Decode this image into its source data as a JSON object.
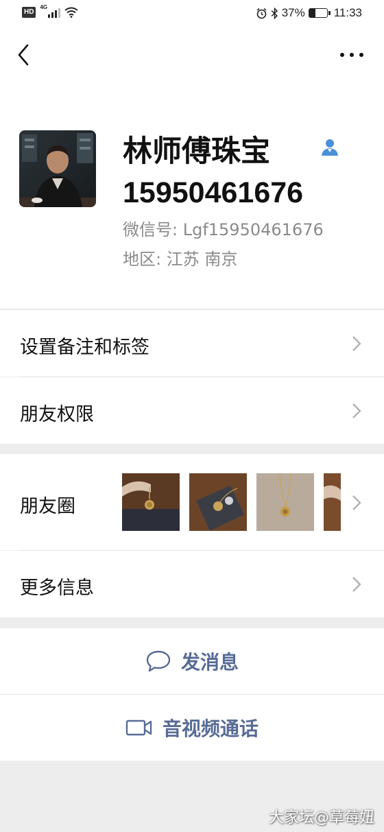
{
  "status_bar": {
    "hd": "HD",
    "network": "4G",
    "battery": "37%",
    "battery_level": 0.37,
    "time": "11:33"
  },
  "profile": {
    "name_line1": "林师傅珠宝",
    "name_line2": "15950461676",
    "wechat_id": "微信号:  Lgf15950461676",
    "region": "地区:  江苏  南京"
  },
  "menu": {
    "remarks_tags": "设置备注和标签",
    "friend_permissions": "朋友权限",
    "moments": "朋友圈",
    "more_info": "更多信息"
  },
  "actions": {
    "send_message": "发消息",
    "video_call": "音视频通话"
  },
  "watermark": "大家坛@草莓妞",
  "colors": {
    "link_blue": "#576b95",
    "contact_icon_blue": "#4a90d9"
  }
}
